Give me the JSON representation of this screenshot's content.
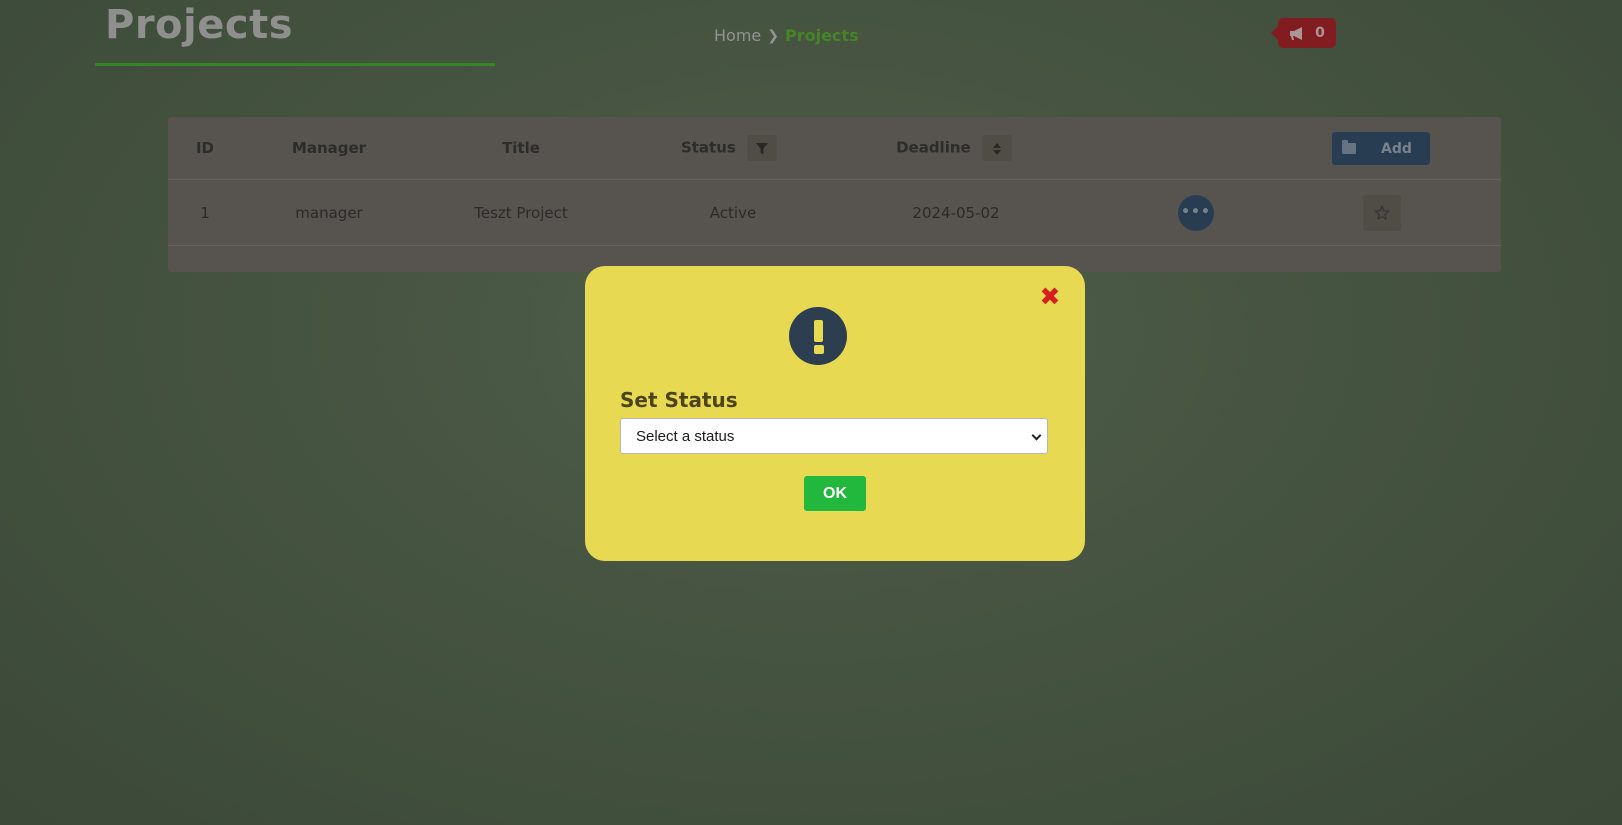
{
  "header": {
    "title": "Projects",
    "breadcrumb": {
      "home": "Home",
      "separator": "❯",
      "current": "Projects"
    },
    "notifications": {
      "icon": "megaphone-icon",
      "count": "0"
    }
  },
  "table": {
    "columns": {
      "id": "ID",
      "manager": "Manager",
      "title": "Title",
      "status": "Status",
      "deadline": "Deadline"
    },
    "status_filter_icon": "filter-icon",
    "deadline_sort_icon": "sort-icon",
    "add_button": {
      "label": "Add",
      "icon": "folder-open-icon"
    },
    "rows": [
      {
        "id": "1",
        "manager": "manager",
        "title": "Teszt Project",
        "status": "Active",
        "deadline": "2024-05-02",
        "more_label": "•••",
        "favorite_icon": "star-icon"
      }
    ]
  },
  "dialog": {
    "icon": "exclamation-icon",
    "close_icon": "✖",
    "title": "Set Status",
    "select": {
      "selected": "Select a status"
    },
    "ok_label": "OK"
  },
  "colors": {
    "dialog_bg": "#e8d953",
    "ok_button": "#21b83d",
    "close_icon": "#d42020",
    "alert_icon_bg": "#2c3e50",
    "accent_green": "#4a8e2c",
    "badge_red": "#8a1e22"
  }
}
